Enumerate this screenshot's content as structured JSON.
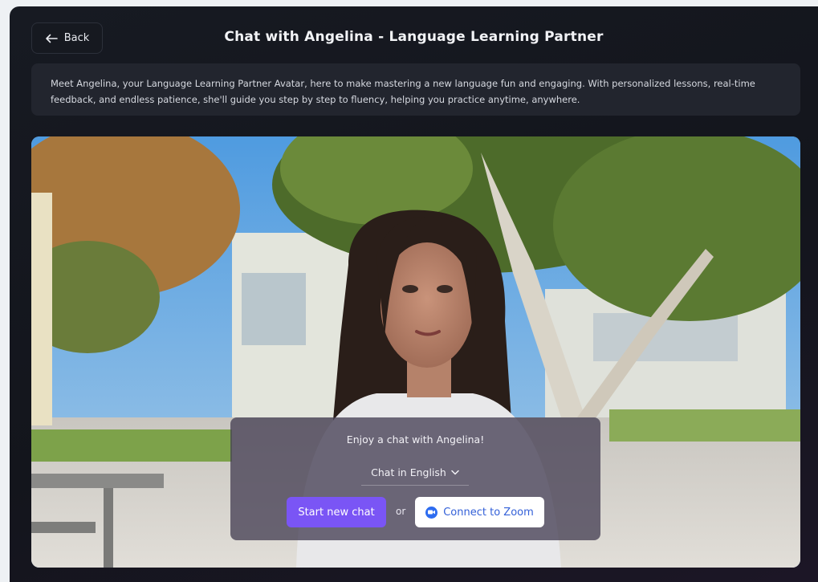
{
  "header": {
    "back_label": "Back",
    "title": "Chat with Angelina - Language Learning Partner"
  },
  "description": "Meet Angelina, your Language Learning Partner Avatar, here to make mastering a new language fun and engaging. With personalized lessons, real-time feedback, and endless patience, she'll guide you step by step to fluency, helping you practice anytime, anywhere.",
  "overlay": {
    "heading": "Enjoy a chat with Angelina!",
    "language_selected": "Chat in English",
    "start_label": "Start new chat",
    "or_label": "or",
    "zoom_label": "Connect to Zoom"
  },
  "icons": {
    "back": "arrow-left-icon",
    "dropdown": "chevron-down-icon",
    "zoom": "zoom-logo-icon"
  },
  "colors": {
    "accent": "#7a55f5",
    "zoom_blue": "#2d6cf0",
    "background": "#14171e"
  }
}
